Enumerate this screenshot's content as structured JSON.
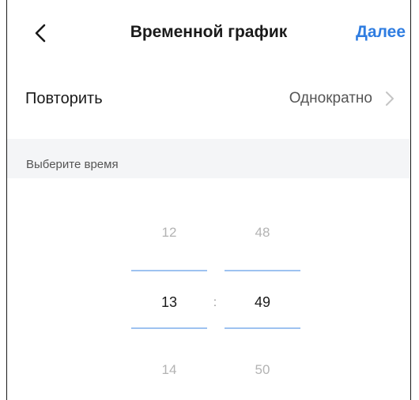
{
  "header": {
    "back_icon": "chevron-left-icon",
    "title": "Временной график",
    "next_label": "Далее",
    "accent_color": "#2f7de1"
  },
  "repeat": {
    "label": "Повторить",
    "value": "Однократно",
    "chevron_icon": "chevron-right-icon"
  },
  "time_section": {
    "label": "Выберите время"
  },
  "time_picker": {
    "hours": {
      "prev": "12",
      "current": "13",
      "next": "14"
    },
    "separator": ":",
    "minutes": {
      "prev": "48",
      "current": "49",
      "next": "50"
    },
    "selection_line_color": "#9ec2f0"
  }
}
